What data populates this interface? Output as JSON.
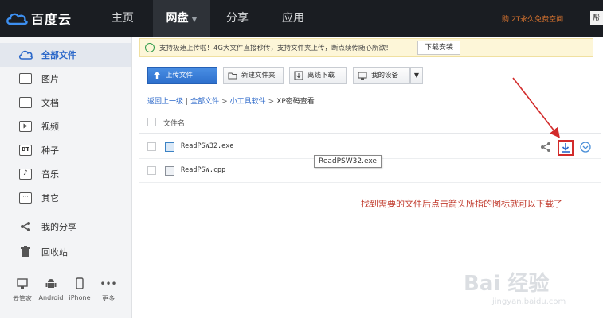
{
  "header": {
    "logo_text": "百度云",
    "nav": [
      {
        "label": "主页"
      },
      {
        "label": "网盘",
        "active": true
      },
      {
        "label": "分享"
      },
      {
        "label": "应用"
      }
    ],
    "promo_text": "购 2T永久免费空间",
    "top_right_box": "帮"
  },
  "sidebar": {
    "items": [
      {
        "label": "全部文件",
        "icon": "cloud-icon",
        "active": true
      },
      {
        "label": "图片",
        "icon": "image-icon"
      },
      {
        "label": "文档",
        "icon": "document-icon"
      },
      {
        "label": "视频",
        "icon": "video-icon"
      },
      {
        "label": "种子",
        "icon": "torrent-icon"
      },
      {
        "label": "音乐",
        "icon": "music-icon"
      },
      {
        "label": "其它",
        "icon": "other-icon"
      },
      {
        "label": "我的分享",
        "icon": "share-icon"
      },
      {
        "label": "回收站",
        "icon": "trash-icon"
      }
    ],
    "devices": [
      {
        "label": "云管家",
        "icon": "desktop-icon"
      },
      {
        "label": "Android",
        "icon": "android-icon"
      },
      {
        "label": "iPhone",
        "icon": "iphone-icon"
      },
      {
        "label": "更多",
        "icon": "more-icon"
      }
    ]
  },
  "notice": {
    "text": "支持极速上传啦！4G大文件直接秒传，支持文件夹上传，断点续传随心所欲！",
    "button_label": "下载安装"
  },
  "toolbar": {
    "upload_label": "上传文件",
    "new_folder_label": "新建文件夹",
    "offline_download_label": "离线下载",
    "my_devices_label": "我的设备",
    "caret": "▼"
  },
  "breadcrumb": {
    "back": "返回上一级",
    "sep": "|",
    "all_files": "全部文件",
    "arrow": ">",
    "folder": "小工具软件",
    "current": "XP密码查看"
  },
  "file_list": {
    "column_title": "文件名",
    "files": [
      {
        "name": "ReadPSW32.exe",
        "type": "exe"
      },
      {
        "name": "ReadPSW.cpp",
        "type": "cpp"
      }
    ],
    "tooltip": "ReadPSW32.exe"
  },
  "annotation": "找到需要的文件后点击箭头所指的图标就可以下载了",
  "watermark": {
    "text": "Bai 经验",
    "url": "jingyan.baidu.com"
  },
  "colors": {
    "topbar": "#1a1d22",
    "accent_blue": "#2a67c9",
    "highlight_red": "#d22b2b",
    "annotation_red": "#c0392b",
    "notice_bg": "#fdf6d8"
  }
}
